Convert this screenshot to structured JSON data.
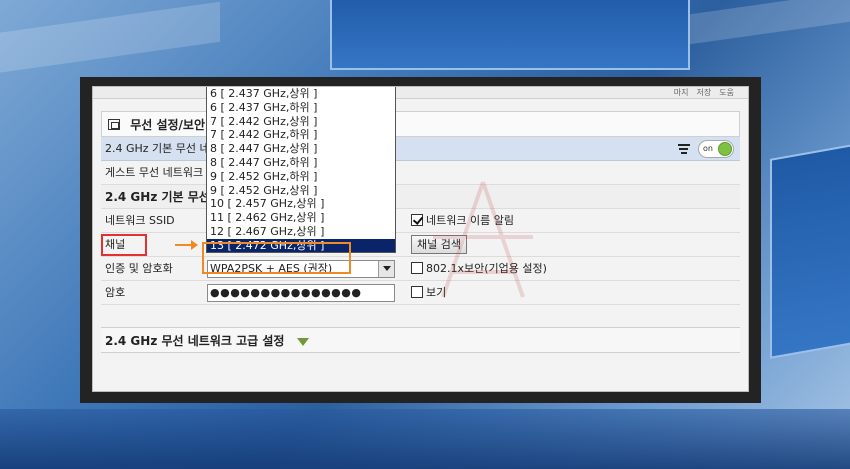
{
  "topbar": {
    "links": [
      "마지",
      "저장",
      "도움"
    ]
  },
  "title": "무선 설정/보안",
  "basic_bar": {
    "label": "2.4 GHz 기본 무선 네트워크",
    "toggle_text": "on"
  },
  "guest_row": {
    "label": "게스트 무선 네트워크"
  },
  "basic_section": {
    "label": "2.4 GHz 기본 무선 네트워크"
  },
  "ssid": {
    "label": "네트워크 SSID",
    "broadcast_label": "네트워크 이름 알림",
    "broadcast_checked": true
  },
  "channel": {
    "label": "채널",
    "scan_button": "채널 검색"
  },
  "auth": {
    "label": "인증 및 암호화",
    "value": "WPA2PSK + AES (권장)",
    "enterprise_label": "802.1x보안(기업용 설정)",
    "enterprise_checked": false
  },
  "password": {
    "label": "암호",
    "value": "●●●●●●●●●●●●●●●",
    "show_label": "보기",
    "show_checked": false
  },
  "advanced": {
    "label": "2.4 GHz 무선 네트워크 고급 설정"
  },
  "channel_options": [
    "6 [ 2.437 GHz,상위 ]",
    "6 [ 2.437 GHz,하위 ]",
    "7 [ 2.442 GHz,상위 ]",
    "7 [ 2.442 GHz,하위 ]",
    "8 [ 2.447 GHz,상위 ]",
    "8 [ 2.447 GHz,하위 ]",
    "9 [ 2.452 GHz,하위 ]",
    "9 [ 2.452 GHz,상위 ]",
    "10 [ 2.457 GHz,상위 ]",
    "11 [ 2.462 GHz,상위 ]",
    "12 [ 2.467 GHz,상위 ]",
    "13 [ 2.472 GHz,상위 ]"
  ],
  "selected_channel_index": 11,
  "colors": {
    "selected_bg": "#0a246a",
    "highlight_orange": "#f08a24",
    "highlight_red": "#e53030",
    "toggle_green": "#7dc242"
  }
}
